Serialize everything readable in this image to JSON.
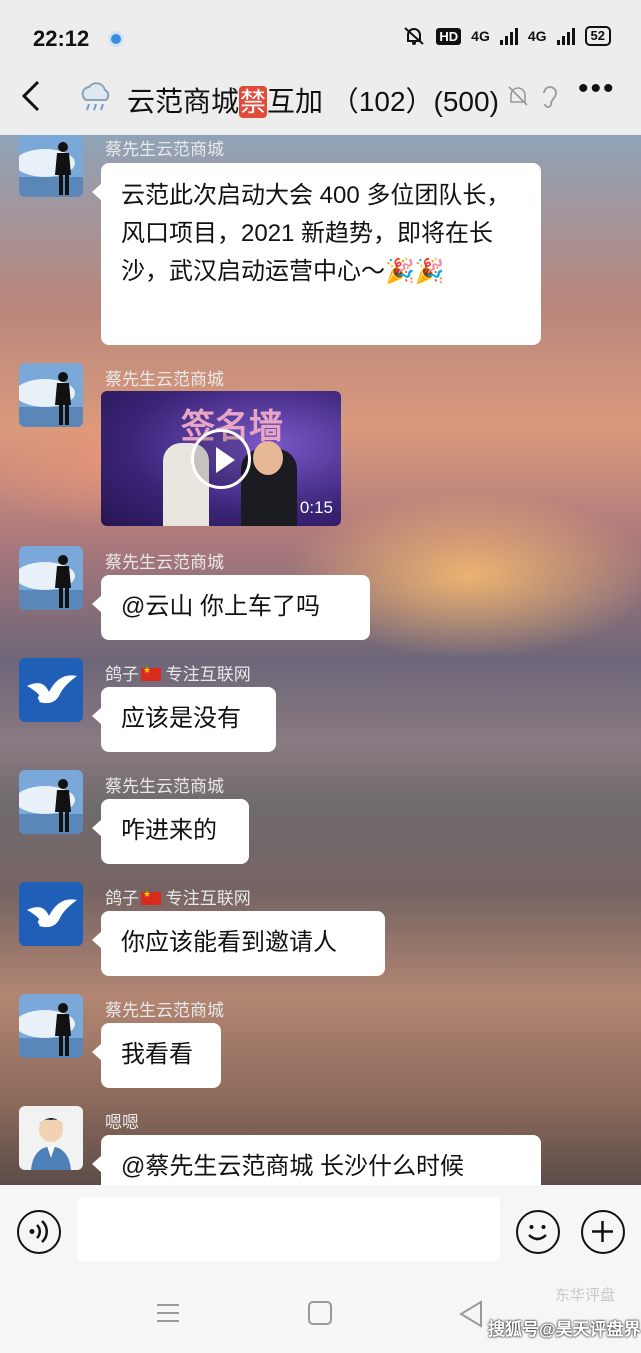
{
  "status_bar": {
    "time": "22:12",
    "hd": "HD",
    "net1": "4G",
    "net2": "4G",
    "battery": "52"
  },
  "header": {
    "title_prefix": "云范商城",
    "ban_badge": "禁",
    "title_suffix": "互加 （102）(500)"
  },
  "messages": [
    {
      "sender": "蔡先生云范商城",
      "text": "云范此次启动大会 400 多位团队长，风口项目，2021 新趋势，即将在长沙，武汉启动运营中心～🎉🎉"
    },
    {
      "sender": "蔡先生云范商城",
      "video_title": "签名墙",
      "video_duration": "0:15"
    },
    {
      "sender": "蔡先生云范商城",
      "text": "@云山  你上车了吗"
    },
    {
      "sender_name": "鸽子",
      "sender_note": "专注互联网",
      "text": "应该是没有"
    },
    {
      "sender": "蔡先生云范商城",
      "text": "咋进来的"
    },
    {
      "sender_name": "鸽子",
      "sender_note": "专注互联网",
      "text": "你应该能看到邀请人"
    },
    {
      "sender": "蔡先生云范商城",
      "text": "我看看"
    },
    {
      "sender": "嗯嗯",
      "text": "@蔡先生云范商城  长沙什么时候"
    }
  ],
  "input": {
    "value": ""
  },
  "watermark": {
    "line1": "东华评盘",
    "line2": "搜狐号@昊天评盘界"
  },
  "colors": {
    "header_bg": "#ededed",
    "bubble_bg": "#ffffff",
    "ban_badge": "#e04b3a",
    "sender_text": "#e8e8e8"
  }
}
